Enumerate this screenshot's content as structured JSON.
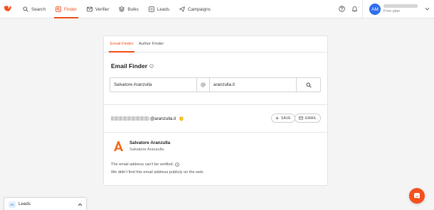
{
  "nav": {
    "items": [
      {
        "label": "Search",
        "icon": "search-icon"
      },
      {
        "label": "Finder",
        "icon": "finder-icon",
        "active": true
      },
      {
        "label": "Verifier",
        "icon": "verifier-icon"
      },
      {
        "label": "Bulks",
        "icon": "bulks-icon"
      },
      {
        "label": "Leads",
        "icon": "leads-icon"
      },
      {
        "label": "Campaigns",
        "icon": "campaigns-icon"
      }
    ]
  },
  "account": {
    "initials": "AM",
    "plan": "Free plan"
  },
  "tabs": [
    "Email Finder",
    "Author Finder"
  ],
  "finder": {
    "title": "Email Finder",
    "name_value": "Salvatore Aranzulla",
    "domain_value": "aranzulla.it"
  },
  "result": {
    "email_domain": "@aranzulla.it",
    "save_label": "SAVE",
    "email_label": "EMAIL"
  },
  "person": {
    "name": "Salvatore Aranzulla",
    "org": "Salvatore Aranzulla"
  },
  "notes": {
    "unverified": "The email address can't be verified.",
    "not_found": "We didn't find this email address publicly on the web."
  },
  "leads_panel": {
    "badge": "JA",
    "label": "Leads"
  },
  "colors": {
    "accent": "#f4511e",
    "avatar": "#2f6fed"
  }
}
